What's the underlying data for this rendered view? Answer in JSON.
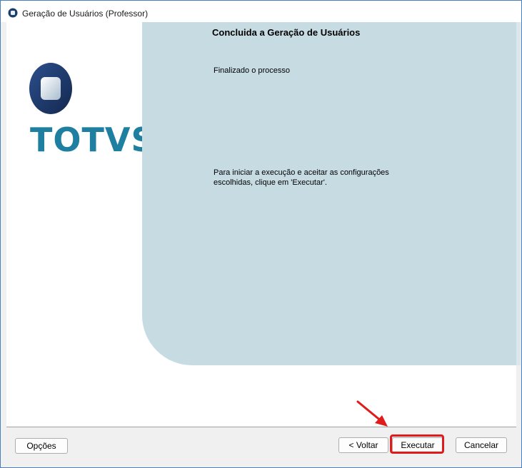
{
  "window": {
    "title": "Geração de Usuários (Professor)"
  },
  "logo": {
    "brand": "TOTVS"
  },
  "panel": {
    "title": "Concluida a Geração de Usuários",
    "status": "Finalizado o processo",
    "instruction": "Para iniciar a execução e aceitar as configurações escolhidas, clique em 'Executar'."
  },
  "footer": {
    "options_label": "Opções",
    "back_label": "< Voltar",
    "execute_label": "Executar",
    "cancel_label": "Cancelar"
  },
  "colors": {
    "panel_bg": "#c7dbe3",
    "brand": "#1e7fa0",
    "highlight": "#e01b1b"
  },
  "icons": {
    "app": "totvs-app-icon",
    "arrow": "arrow-annotation-icon"
  }
}
